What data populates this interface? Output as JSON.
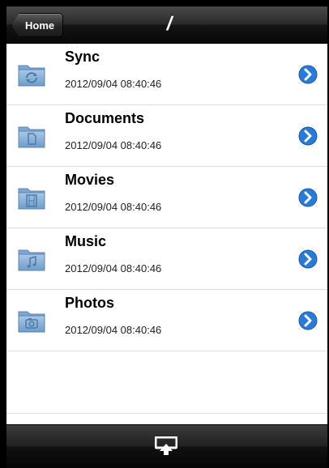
{
  "navbar": {
    "back_label": "Home",
    "title": "/"
  },
  "items": [
    {
      "name": "Sync",
      "date": "2012/09/04 08:40:46",
      "icon": "sync-folder-icon"
    },
    {
      "name": "Documents",
      "date": "2012/09/04 08:40:46",
      "icon": "documents-folder-icon"
    },
    {
      "name": "Movies",
      "date": "2012/09/04 08:40:46",
      "icon": "movies-folder-icon"
    },
    {
      "name": "Music",
      "date": "2012/09/04 08:40:46",
      "icon": "music-folder-icon"
    },
    {
      "name": "Photos",
      "date": "2012/09/04 08:40:46",
      "icon": "photos-folder-icon"
    }
  ],
  "toolbar": {
    "upload_icon": "upload-icon"
  },
  "colors": {
    "disclosure_blue": "#2a7bd6",
    "folder_blue": "#8fb4d8",
    "bar_dark": "#1a1a1a"
  }
}
